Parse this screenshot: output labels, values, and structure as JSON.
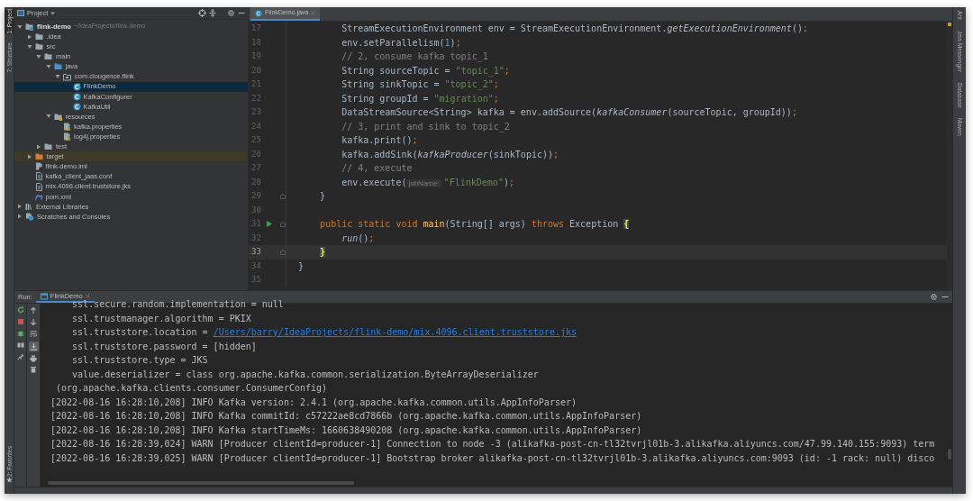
{
  "left_tool_strip": [
    {
      "label": "1: Project",
      "selected": true
    },
    {
      "label": "7: Structure",
      "selected": false
    }
  ],
  "left_bottom_strip": [
    {
      "label": "2: Favorites",
      "selected": false
    }
  ],
  "project_panel": {
    "title": "Project",
    "tree": [
      {
        "label": "flink-demo",
        "kind": "module",
        "hint": "~/IdeaProjects/flink-demo",
        "expanded": true,
        "selected": false,
        "children": [
          {
            "label": ".idea",
            "kind": "folder",
            "expanded": false,
            "selected": false
          },
          {
            "label": "src",
            "kind": "folder",
            "expanded": true,
            "selected": false,
            "children": [
              {
                "label": "main",
                "kind": "folder",
                "expanded": true,
                "selected": false,
                "children": [
                  {
                    "label": "java",
                    "kind": "source",
                    "expanded": true,
                    "selected": false,
                    "children": [
                      {
                        "label": "com.clougence.flink",
                        "kind": "package",
                        "expanded": true,
                        "selected": false,
                        "children": [
                          {
                            "label": "FlinkDemo",
                            "kind": "main-class",
                            "selected": true
                          },
                          {
                            "label": "KafkaConfigurer",
                            "kind": "class",
                            "selected": false
                          },
                          {
                            "label": "KafkaUtil",
                            "kind": "class",
                            "selected": false
                          }
                        ]
                      }
                    ]
                  },
                  {
                    "label": "resources",
                    "kind": "resources",
                    "expanded": true,
                    "selected": false,
                    "children": [
                      {
                        "label": "kafka.properties",
                        "kind": "properties",
                        "selected": false
                      },
                      {
                        "label": "log4j.properties",
                        "kind": "properties",
                        "selected": false
                      }
                    ]
                  }
                ]
              },
              {
                "label": "test",
                "kind": "folder",
                "expanded": false,
                "selected": false
              }
            ]
          },
          {
            "label": "target",
            "kind": "excluded",
            "expanded": false,
            "selected": false
          },
          {
            "label": "flink-demo.iml",
            "kind": "iml",
            "selected": false
          },
          {
            "label": "kafka_client_jaas.conf",
            "kind": "file",
            "selected": false
          },
          {
            "label": "mix.4096.client.truststore.jks",
            "kind": "file",
            "selected": false
          },
          {
            "label": "pom.xml",
            "kind": "maven",
            "selected": false
          }
        ]
      },
      {
        "label": "External Libraries",
        "kind": "libraries",
        "expanded": false,
        "selected": false
      },
      {
        "label": "Scratches and Consoles",
        "kind": "scratches",
        "expanded": false,
        "selected": false
      }
    ]
  },
  "editor": {
    "tabs": [
      {
        "label": "FlinkDemo.java",
        "selected": true
      }
    ],
    "lines": [
      {
        "number": "17",
        "tokens": [
          {
            "text": "        StreamExecutionEnvironment env = StreamExecutionEnvironment.",
            "kind": "plain"
          },
          {
            "text": "getExecutionEnvironment",
            "kind": "static"
          },
          {
            "text": "()",
            "kind": "plain"
          },
          {
            "text": ";",
            "kind": "semi"
          }
        ]
      },
      {
        "number": "18",
        "tokens": [
          {
            "text": "        env.setParallelism(",
            "kind": "plain"
          },
          {
            "text": "1",
            "kind": "number"
          },
          {
            "text": ")",
            "kind": "plain"
          },
          {
            "text": ";",
            "kind": "semi"
          }
        ]
      },
      {
        "number": "19",
        "tokens": [
          {
            "text": "        // 2, consume kafka topic_1",
            "kind": "comment"
          }
        ]
      },
      {
        "number": "20",
        "tokens": [
          {
            "text": "        String sourceTopic = ",
            "kind": "plain"
          },
          {
            "text": "\"topic_1\"",
            "kind": "string"
          },
          {
            "text": ";",
            "kind": "semi"
          }
        ]
      },
      {
        "number": "21",
        "tokens": [
          {
            "text": "        String sinkTopic = ",
            "kind": "plain"
          },
          {
            "text": "\"topic_2\"",
            "kind": "string"
          },
          {
            "text": ";",
            "kind": "semi"
          }
        ]
      },
      {
        "number": "22",
        "tokens": [
          {
            "text": "        String groupId = ",
            "kind": "plain"
          },
          {
            "text": "\"migration\"",
            "kind": "string"
          },
          {
            "text": ";",
            "kind": "semi"
          }
        ]
      },
      {
        "number": "23",
        "tokens": [
          {
            "text": "        DataStreamSource<String> kafka = env.addSource(",
            "kind": "plain"
          },
          {
            "text": "kafkaConsumer",
            "kind": "static"
          },
          {
            "text": "(sourceTopic, groupId))",
            "kind": "plain"
          },
          {
            "text": ";",
            "kind": "semi"
          }
        ]
      },
      {
        "number": "24",
        "tokens": [
          {
            "text": "        // 3, print and sink to topic_2",
            "kind": "comment"
          }
        ]
      },
      {
        "number": "25",
        "tokens": [
          {
            "text": "        kafka.print()",
            "kind": "plain"
          },
          {
            "text": ";",
            "kind": "semi"
          }
        ]
      },
      {
        "number": "26",
        "tokens": [
          {
            "text": "        kafka.addSink(",
            "kind": "plain"
          },
          {
            "text": "kafkaProducer",
            "kind": "static"
          },
          {
            "text": "(sinkTopic))",
            "kind": "plain"
          },
          {
            "text": ";",
            "kind": "semi"
          }
        ]
      },
      {
        "number": "27",
        "tokens": [
          {
            "text": "        // 4, execute",
            "kind": "comment"
          }
        ]
      },
      {
        "number": "28",
        "tokens": [
          {
            "text": "        env.execute(",
            "kind": "plain"
          },
          {
            "text": "jobName:",
            "kind": "hint"
          },
          {
            "text": "\"FlinkDemo\"",
            "kind": "string"
          },
          {
            "text": ")",
            "kind": "plain"
          },
          {
            "text": ";",
            "kind": "semi"
          }
        ]
      },
      {
        "number": "29",
        "fold": true,
        "tokens": [
          {
            "text": "    }",
            "kind": "plain"
          }
        ]
      },
      {
        "number": "30"
      },
      {
        "number": "31",
        "run_marker": true,
        "fold": true,
        "tokens": [
          {
            "text": "    public static void ",
            "kind": "keyword"
          },
          {
            "text": "main",
            "kind": "decl"
          },
          {
            "text": "(String[] args) ",
            "kind": "plain"
          },
          {
            "text": "throws",
            "kind": "keyword"
          },
          {
            "text": " Exception ",
            "kind": "plain"
          },
          {
            "text": "{",
            "kind": "brace"
          }
        ]
      },
      {
        "number": "32",
        "tokens": [
          {
            "text": "        run",
            "kind": "static"
          },
          {
            "text": "()",
            "kind": "plain"
          },
          {
            "text": ";",
            "kind": "semi"
          }
        ]
      },
      {
        "number": "33",
        "current": true,
        "fold": true,
        "tokens": [
          {
            "text": "    }",
            "kind": "brace"
          }
        ]
      },
      {
        "number": "34",
        "tokens": [
          {
            "text": "}",
            "kind": "plain"
          }
        ]
      },
      {
        "number": "35"
      }
    ]
  },
  "right_tool_strip": [
    {
      "label": "Ant"
    },
    {
      "label": "Jms Messenger"
    },
    {
      "label": "Database"
    },
    {
      "label": "Maven"
    }
  ],
  "run_panel": {
    "label": "Run:",
    "tabs": [
      {
        "label": "FlinkDemo",
        "selected": true
      }
    ],
    "console": [
      {
        "segments": [
          {
            "text": "    ssl.secure.random.implementation = null"
          }
        ]
      },
      {
        "segments": [
          {
            "text": "    ssl.trustmanager.algorithm = PKIX"
          }
        ]
      },
      {
        "segments": [
          {
            "text": "    ssl.truststore.location = "
          },
          {
            "text": "/Users/barry/IdeaProjects/flink-demo/mix.4096.client.truststore.jks",
            "kind": "link"
          }
        ]
      },
      {
        "segments": [
          {
            "text": "    ssl.truststore.password = [hidden]"
          }
        ]
      },
      {
        "segments": [
          {
            "text": "    ssl.truststore.type = JKS"
          }
        ]
      },
      {
        "segments": [
          {
            "text": "    value.deserializer = class org.apache.kafka.common.serialization.ByteArrayDeserializer"
          }
        ]
      },
      {
        "segments": [
          {
            "text": " (org.apache.kafka.clients.consumer.ConsumerConfig)"
          }
        ]
      },
      {
        "segments": [
          {
            "text": "[2022-08-16 16:28:10,208] INFO Kafka version: 2.4.1 (org.apache.kafka.common.utils.AppInfoParser)"
          }
        ]
      },
      {
        "segments": [
          {
            "text": "[2022-08-16 16:28:10,208] INFO Kafka commitId: c57222ae8cd7866b (org.apache.kafka.common.utils.AppInfoParser)"
          }
        ]
      },
      {
        "segments": [
          {
            "text": "[2022-08-16 16:28:10,208] INFO Kafka startTimeMs: 1660638490208 (org.apache.kafka.common.utils.AppInfoParser)"
          }
        ]
      },
      {
        "segments": [
          {
            "text": "[2022-08-16 16:28:39,024] WARN [Producer clientId=producer-1] Connection to node -3 (alikafka-post-cn-tl32tvrjl01b-3.alikafka.aliyuncs.com/47.99.140.155:9093) term"
          }
        ]
      },
      {
        "segments": [
          {
            "text": "[2022-08-16 16:28:39,025] WARN [Producer clientId=producer-1] Bootstrap broker alikafka-post-cn-tl32tvrjl01b-3.alikafka.aliyuncs.com:9093 (id: -1 rack: null) disco"
          }
        ]
      }
    ]
  }
}
